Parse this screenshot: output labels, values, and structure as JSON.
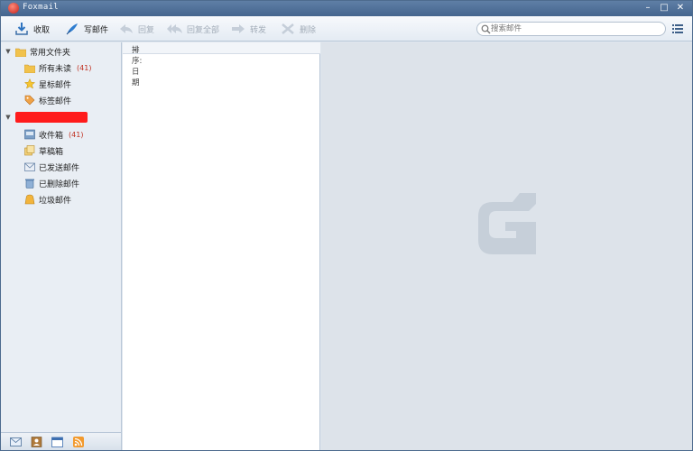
{
  "window": {
    "title": "Foxmail"
  },
  "toolbar": {
    "receive": "收取",
    "compose": "写邮件",
    "reply": "回复",
    "reply_all": "回复全部",
    "forward": "转发",
    "delete": "删除"
  },
  "search": {
    "placeholder": "搜索邮件"
  },
  "sidebar": {
    "favorites_header": "常用文件夹",
    "favorites": [
      {
        "label": "所有未读",
        "count": "(41)"
      },
      {
        "label": "星标邮件",
        "count": ""
      },
      {
        "label": "标签邮件",
        "count": ""
      }
    ],
    "account": {
      "folders": [
        {
          "label": "收件箱",
          "count": "(41)"
        },
        {
          "label": "草稿箱",
          "count": ""
        },
        {
          "label": "已发送邮件",
          "count": ""
        },
        {
          "label": "已删除邮件",
          "count": ""
        },
        {
          "label": "垃圾邮件",
          "count": ""
        }
      ]
    }
  },
  "list": {
    "sort_label": "排序: 日期"
  },
  "icons": [
    "app-logo-icon",
    "receive-icon",
    "compose-icon",
    "reply-icon",
    "reply-all-icon",
    "forward-icon",
    "delete-icon",
    "search-icon",
    "menu-icon",
    "folder-icon",
    "star-icon",
    "tag-icon",
    "inbox-icon",
    "draft-icon",
    "sent-icon",
    "trash-icon",
    "junk-icon",
    "mail-icon",
    "contacts-icon",
    "calendar-icon",
    "rss-icon",
    "foxmail-watermark-icon"
  ],
  "colors": {
    "titlebar": "#4f6f97",
    "redaction": "#ff1b1b",
    "count": "#c03020",
    "preview_bg": "#dde3ea"
  }
}
